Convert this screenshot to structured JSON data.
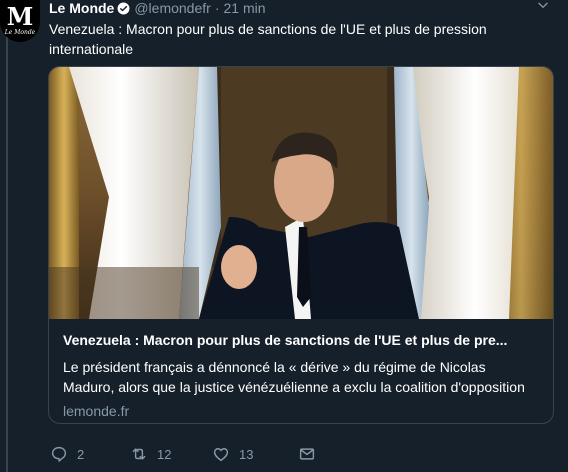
{
  "tweet": {
    "author_name": "Le Monde",
    "handle": "@lemondefr",
    "separator": "·",
    "time": "21 min",
    "avatar_glyph": "M",
    "avatar_sub": "Le Monde",
    "text": "Venezuela : Macron pour plus de sanctions de l'UE et plus de pression internationale"
  },
  "card": {
    "title": "Venezuela : Macron pour plus de sanctions de l'UE et plus de pre...",
    "description": "Le président français a dénnoncé la « dérive » du régime de Nicolas Maduro, alors que la justice vénézuélienne a exclu la coalition d'opposition",
    "domain": "lemonde.fr"
  },
  "actions": {
    "replies": "2",
    "retweets": "12",
    "likes": "13"
  },
  "icons": {
    "verified": "verified-badge-icon",
    "menu": "chevron-down-icon",
    "reply": "reply-icon",
    "retweet": "retweet-icon",
    "like": "heart-icon",
    "message": "envelope-icon"
  },
  "colors": {
    "background": "#15202b",
    "muted": "#8899a6",
    "accent": "#1da1f2",
    "border": "#38444d"
  }
}
